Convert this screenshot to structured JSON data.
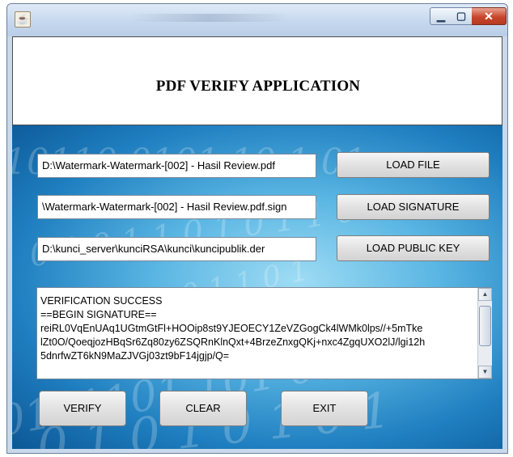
{
  "window": {
    "app_icon": "java-icon",
    "min_icon": "minimize-icon",
    "max_icon": "maximize-icon",
    "close_icon": "close-icon"
  },
  "header": {
    "title": "PDF VERIFY APPLICATION"
  },
  "form": {
    "file_path": "D:\\Watermark-Watermark-[002] - Hasil Review.pdf",
    "signature_path": "\\Watermark-Watermark-[002] - Hasil Review.pdf.sign",
    "public_key_path": "D:\\kunci_server\\kunciRSA\\kunci\\kuncipublik.der",
    "load_file_label": "LOAD FILE",
    "load_signature_label": "LOAD SIGNATURE",
    "load_public_key_label": "LOAD PUBLIC KEY"
  },
  "output": {
    "lines": [
      "VERIFICATION SUCCESS",
      "==BEGIN SIGNATURE==",
      "reiRL0VqEnUAq1UGtmGtFl+HOOip8st9YJEOECY1ZeVZGogCk4lWMk0lps//+5mTke",
      "lZt0O/QoeqjozHBqSr6Zq80zy6ZSQRnKlnQxt+4BrzeZnxgQKj+nxc4ZgqUXO2lJ/lgi12h",
      "5dnrfwZT6kN9MaZJVGj03zt9bF14jgjp/Q="
    ]
  },
  "actions": {
    "verify_label": "VERIFY",
    "clear_label": "CLEAR",
    "exit_label": "EXIT"
  },
  "colors": {
    "background_blue": "#1f7fc0",
    "close_button": "#c7462c"
  }
}
